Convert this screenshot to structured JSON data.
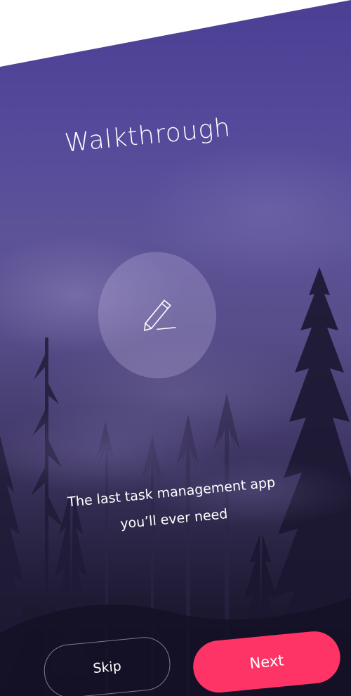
{
  "walkthrough": {
    "title": "Walkthrough",
    "icon": "pencil-icon",
    "tagline_line1": "The last task management app",
    "tagline_line2": "you’ll ever need",
    "skip_label": "Skip",
    "next_label": "Next"
  },
  "colors": {
    "background_top": "#4a3f93",
    "background_bottom": "#151224",
    "accent": "#ff3466",
    "text": "#ffffff"
  }
}
